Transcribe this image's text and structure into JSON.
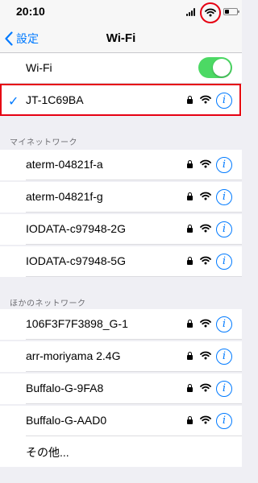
{
  "status_bar": {
    "time": "20:10",
    "battery_level": 0.3
  },
  "nav": {
    "back_label": "設定",
    "title": "Wi-Fi"
  },
  "wifi_toggle": {
    "label": "Wi-Fi",
    "on": true,
    "color": "#4cd964"
  },
  "connected": {
    "ssid": "JT-1C69BA",
    "secured": true
  },
  "my_networks": {
    "header": "マイネットワーク",
    "items": [
      {
        "ssid": "aterm-04821f-a"
      },
      {
        "ssid": "aterm-04821f-g"
      },
      {
        "ssid": "IODATA-c97948-2G"
      },
      {
        "ssid": "IODATA-c97948-5G"
      }
    ]
  },
  "other_networks": {
    "header": "ほかのネットワーク",
    "items": [
      {
        "ssid": "106F3F7F3898_G-1"
      },
      {
        "ssid": "arr-moriyama 2.4G"
      },
      {
        "ssid": "Buffalo-G-9FA8"
      },
      {
        "ssid": "Buffalo-G-AAD0"
      }
    ],
    "other_label": "その他..."
  },
  "icons": {
    "checkmark": "✓",
    "info": "i"
  },
  "colors": {
    "accent": "#007aff",
    "highlight": "#e60012"
  }
}
